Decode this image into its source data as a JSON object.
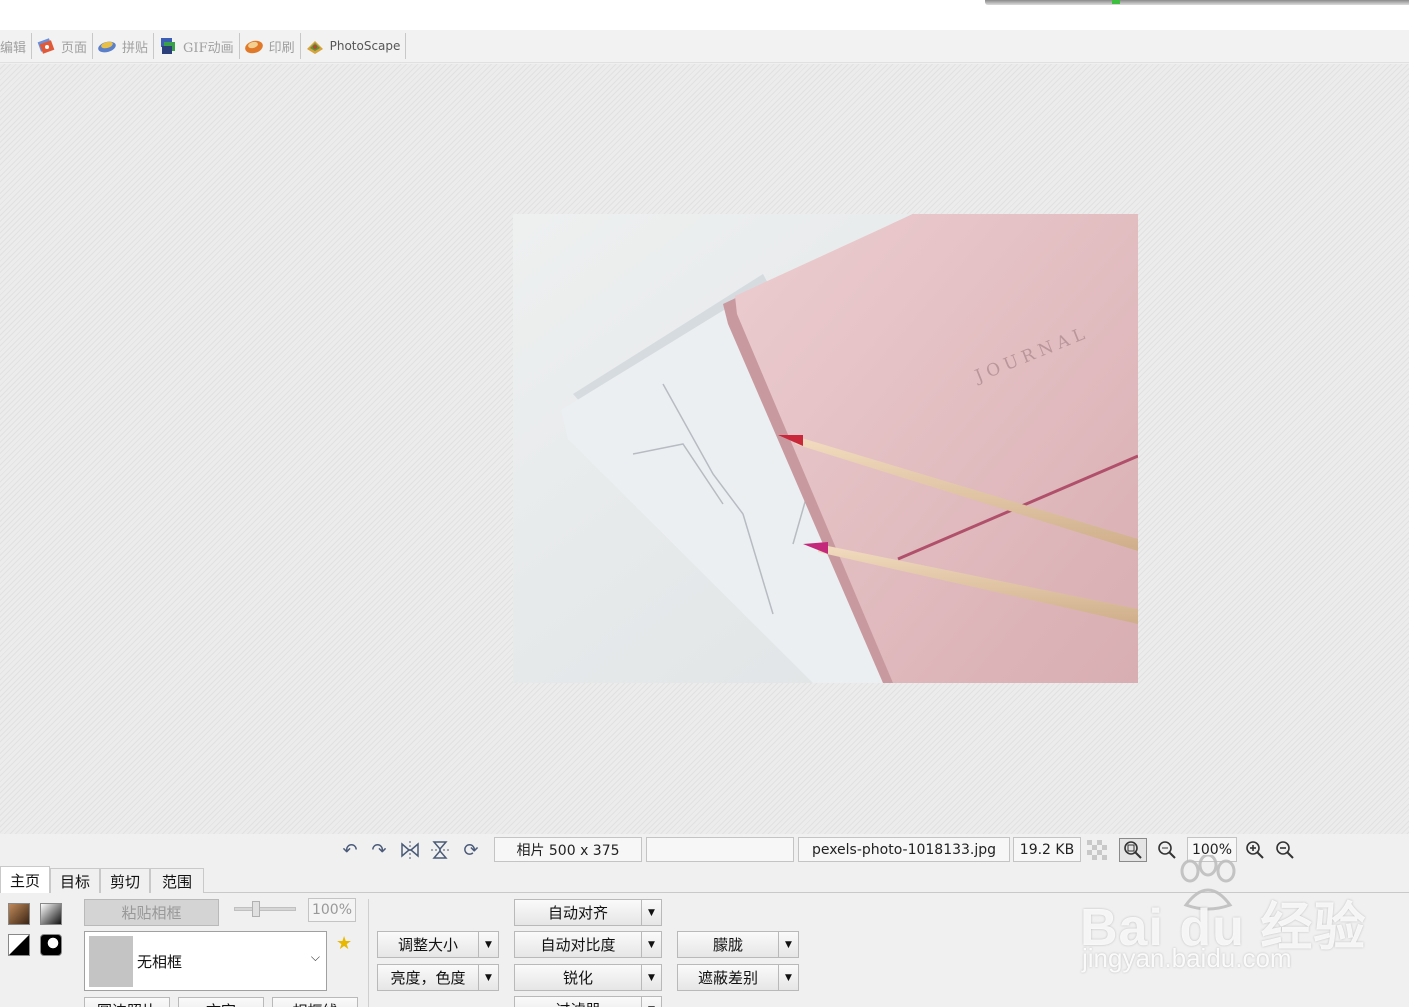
{
  "main_tabs": [
    {
      "label": "编辑",
      "icon": "edit-icon"
    },
    {
      "label": "页面",
      "icon": "page-icon"
    },
    {
      "label": "拼贴",
      "icon": "combine-icon"
    },
    {
      "label": "GIF动画",
      "icon": "gif-animation-icon"
    },
    {
      "label": "印刷",
      "icon": "print-icon"
    },
    {
      "label": "PhotoScape",
      "icon": "photoscape-icon"
    }
  ],
  "photo": {
    "cover_text": "JOURNAL"
  },
  "status": {
    "dimensions": "相片 500 x 375",
    "empty_field": "",
    "filename": "pexels-photo-1018133.jpg",
    "filesize": "19.2 KB",
    "zoom": "100%",
    "icons": [
      "undo-icon",
      "redo-icon",
      "flip-horizontal-icon",
      "flip-vertical-icon",
      "rotate-icon",
      "transparency-checker-icon",
      "zoom-fit-icon",
      "zoom-actual-icon",
      "zoom-in-icon",
      "zoom-out-icon"
    ]
  },
  "sub_tabs": [
    {
      "label": "主页",
      "active": true
    },
    {
      "label": "目标",
      "active": false
    },
    {
      "label": "剪切",
      "active": false
    },
    {
      "label": "范围",
      "active": false
    }
  ],
  "panel": {
    "paste_frame": "粘贴相框",
    "opacity": "100%",
    "frame_select": "无相框",
    "resize": "调整大小",
    "brightness_color": "亮度，色度",
    "auto_level": "自动对齐",
    "auto_contrast": "自动对比度",
    "sharpen": "锐化",
    "filter": "过滤器",
    "bloom": "朦胧",
    "backlight": "遮蔽差别",
    "bottom_buttons": [
      "圆边照片",
      "文字",
      "相框线"
    ]
  },
  "watermark": {
    "brand": "Bai du 经验",
    "url": "jingyan.baidu.com"
  }
}
